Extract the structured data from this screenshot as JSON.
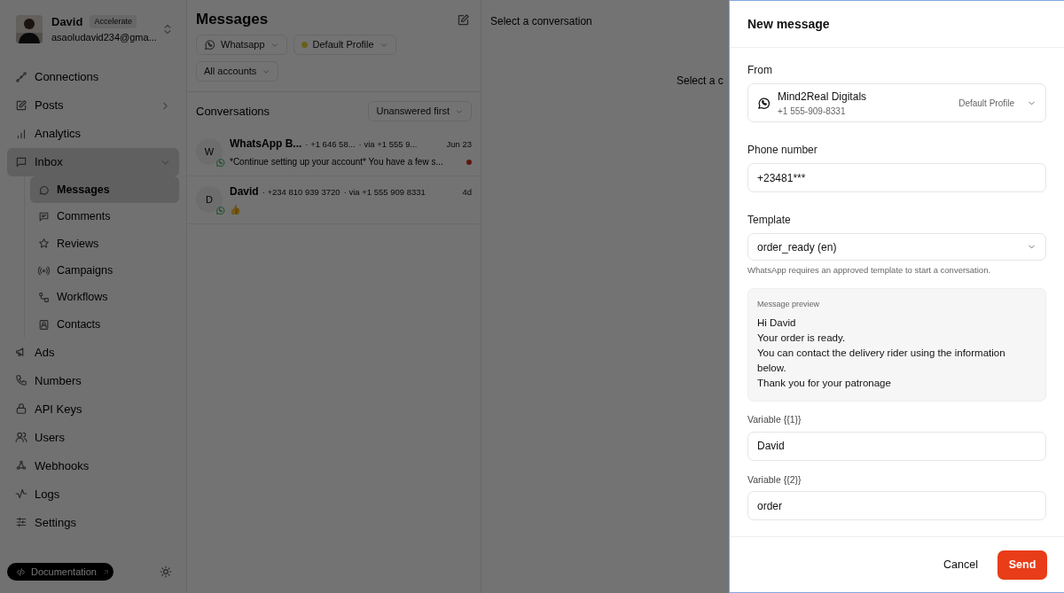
{
  "account": {
    "name": "David",
    "plan": "Accelerate",
    "email": "asaoludavid234@gma..."
  },
  "sidebar": {
    "items": [
      {
        "label": "Connections",
        "selected": false
      },
      {
        "label": "Posts",
        "selected": false,
        "expanded": false
      },
      {
        "label": "Analytics",
        "selected": false
      },
      {
        "label": "Inbox",
        "selected": true,
        "expanded": true,
        "children": [
          {
            "label": "Messages",
            "selected": true
          },
          {
            "label": "Comments",
            "selected": false
          },
          {
            "label": "Reviews",
            "selected": false
          },
          {
            "label": "Campaigns",
            "selected": false
          },
          {
            "label": "Workflows",
            "selected": false
          },
          {
            "label": "Contacts",
            "selected": false
          }
        ]
      },
      {
        "label": "Ads",
        "selected": false
      },
      {
        "label": "Numbers",
        "selected": false
      },
      {
        "label": "API Keys",
        "selected": false
      },
      {
        "label": "Users",
        "selected": false
      },
      {
        "label": "Webhooks",
        "selected": false
      },
      {
        "label": "Logs",
        "selected": false
      },
      {
        "label": "Settings",
        "selected": false
      }
    ],
    "documentation": "Documentation"
  },
  "messages": {
    "title": "Messages",
    "filters": [
      {
        "label": "Whatsapp",
        "kind": "channel"
      },
      {
        "label": "Default Profile",
        "kind": "profile"
      },
      {
        "label": "All accounts",
        "kind": "plain"
      }
    ],
    "conversations_label": "Conversations",
    "sort": "Unanswered first",
    "conversations": [
      {
        "initial": "W",
        "name": "WhatsApp B...",
        "phone": "· +1 646 58...",
        "via": "· via +1 555 9...",
        "time": "Jun 23",
        "preview": "*Continue setting up your account* You have a few s...",
        "unread": true
      },
      {
        "initial": "D",
        "name": "David",
        "phone": "· +234 810 939 3720",
        "via": "· via +1 555 909 8331",
        "time": "4d",
        "preview": "👍",
        "unread": false
      }
    ]
  },
  "conversation_pane": {
    "header": "Select a conversation",
    "placeholder": "Select a c"
  },
  "new_message": {
    "title": "New message",
    "from_label": "From",
    "from": {
      "name": "Mind2Real Digitals",
      "phone": "+1 555-909-8331",
      "profile": "Default Profile"
    },
    "phone_label": "Phone number",
    "phone": "+23481***",
    "template_label": "Template",
    "template": "order_ready (en)",
    "template_help": "WhatsApp requires an approved template to start a conversation.",
    "preview_label": "Message preview",
    "preview": "Hi David\nYour order is ready.\nYou can contact the delivery rider using the information below.\nThank you for your patronage",
    "variables": [
      {
        "label": "Variable {{1}}",
        "value": "David"
      },
      {
        "label": "Variable {{2}}",
        "value": "order"
      }
    ],
    "cancel": "Cancel",
    "send": "Send"
  }
}
